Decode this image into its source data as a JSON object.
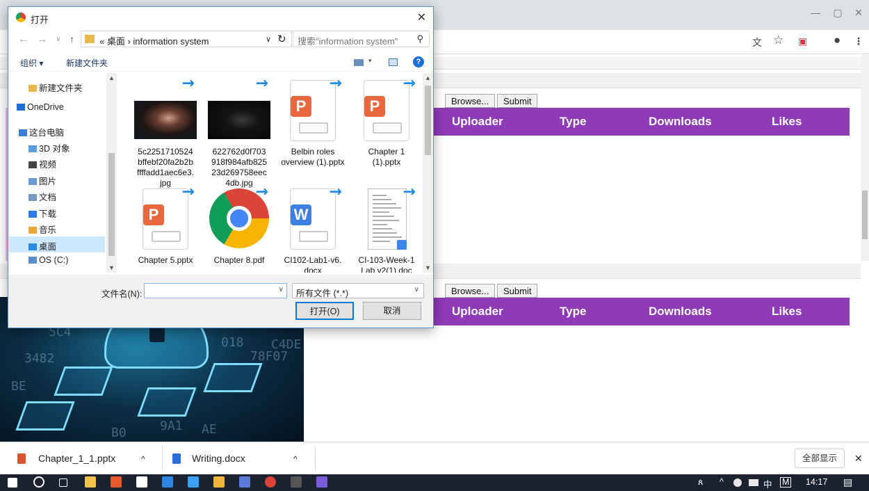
{
  "browser": {
    "window_controls": {
      "minimize": "—",
      "maximize": "▢",
      "close": "✕"
    },
    "toolbar_icons": [
      "translate-icon",
      "star-icon",
      "pocket-icon",
      "profile-icon",
      "menu-icon"
    ],
    "translate_glyph": "文",
    "star_glyph": "☆",
    "pocket_glyph": "▣",
    "profile_glyph": "●",
    "menu_glyph": "⋮",
    "panels": [
      {
        "browse_label": "Browse...",
        "submit_label": "Submit",
        "columns": [
          "Uploader",
          "Type",
          "Downloads",
          "Likes"
        ]
      },
      {
        "browse_label": "Browse...",
        "submit_label": "Submit",
        "columns": [
          "Uploader",
          "Type",
          "Downloads",
          "Likes"
        ]
      }
    ],
    "hero_digits": [
      "5C4",
      "3482",
      "018",
      "BE",
      "9A1",
      "C4DE",
      "78F07",
      "AE",
      "B0"
    ]
  },
  "dialog": {
    "title": "打开",
    "close": "✕",
    "nav": {
      "back": "←",
      "forward": "→",
      "dropdown": "∨",
      "up": "↑"
    },
    "breadcrumb": "« 桌面 › information system",
    "addr_dropdown": "∨",
    "refresh": "↻",
    "search_placeholder": "搜索\"information system\"",
    "search_icon": "⚲",
    "commands": {
      "organize": "组织 ▾",
      "new_folder": "新建文件夹"
    },
    "view_icons": [
      "view-icon",
      "pane-icon",
      "help-icon"
    ],
    "help_glyph": "?",
    "sidebar": [
      {
        "label": "新建文件夹",
        "icon": "folder-icon",
        "color": "#e8b84a",
        "selected": false
      },
      {
        "label": "OneDrive",
        "icon": "onedrive-icon",
        "color": "#1e6fd4",
        "selected": false
      },
      {
        "label": "这台电脑",
        "icon": "computer-icon",
        "color": "#3b7bd8",
        "selected": false
      },
      {
        "label": "3D 对象",
        "icon": "3d-objects-icon",
        "color": "#5aa0e0",
        "selected": false
      },
      {
        "label": "视频",
        "icon": "video-icon",
        "color": "#444444",
        "selected": false
      },
      {
        "label": "图片",
        "icon": "pictures-icon",
        "color": "#6a9bd1",
        "selected": false
      },
      {
        "label": "文档",
        "icon": "documents-icon",
        "color": "#7a98c2",
        "selected": false
      },
      {
        "label": "下载",
        "icon": "downloads-icon",
        "color": "#2a7be4",
        "selected": false
      },
      {
        "label": "音乐",
        "icon": "music-icon",
        "color": "#e8a73a",
        "selected": false
      },
      {
        "label": "桌面",
        "icon": "desktop-icon",
        "color": "#2a8be4",
        "selected": true
      },
      {
        "label": "OS (C:)",
        "icon": "drive-icon",
        "color": "#5a8fcf",
        "selected": false
      }
    ],
    "files": [
      {
        "name": "5c2251710524 bffebf20fa2b2b ffffadd1aec6e3. jpg",
        "kind": "image",
        "icon": "image-thumbnail-icon"
      },
      {
        "name": "622762d0f703 918f984afb825 23d269758eec 4db.jpg",
        "kind": "image-dark",
        "icon": "image-thumbnail-icon"
      },
      {
        "name": "Belbin roles overview (1).pptx",
        "kind": "pptx",
        "icon": "pptx-icon"
      },
      {
        "name": "Chapter 1 (1).pptx",
        "kind": "pptx",
        "icon": "pptx-icon"
      },
      {
        "name": "Chapter 5.pptx",
        "kind": "pptx",
        "icon": "pptx-icon"
      },
      {
        "name": "Chapter 8.pdf",
        "kind": "chrome",
        "icon": "chrome-pdf-icon"
      },
      {
        "name": "CI102-Lab1-v6. docx",
        "kind": "docx",
        "icon": "docx-icon"
      },
      {
        "name": "CI-103-Week-1 Lab v2(1).doc",
        "kind": "doc-preview",
        "icon": "doc-preview-icon"
      }
    ],
    "filename_label": "文件名(N):",
    "filename_value": "",
    "filetype_value": "所有文件 (*.*)",
    "open_button": "打开(O)",
    "cancel_button": "取消",
    "accent": "#0078d7"
  },
  "downloads": {
    "items": [
      {
        "name": "Chapter_1_1.pptx",
        "color": "#d9552b",
        "icon": "pptx-file-icon"
      },
      {
        "name": "Writing.docx",
        "color": "#2b6dd9",
        "icon": "docx-file-icon"
      }
    ],
    "chevron": "^",
    "show_all": "全部显示",
    "close": "✕"
  },
  "taskbar": {
    "apps": [
      "start-icon",
      "cortana-icon",
      "taskview-icon",
      "store-icon",
      "app-orange-icon",
      "mail-icon",
      "app-blue-icon",
      "ie-icon",
      "explorer-icon",
      "app-mixed-icon",
      "chrome-icon",
      "terminal-icon",
      "app-purple-icon"
    ],
    "tray_people": "ጰ",
    "tray_caret": "^",
    "tray_ime": "中",
    "tray_m": "M",
    "time": "14:17",
    "notification": "▤"
  },
  "colors": {
    "purple": "#8e3bb6"
  }
}
